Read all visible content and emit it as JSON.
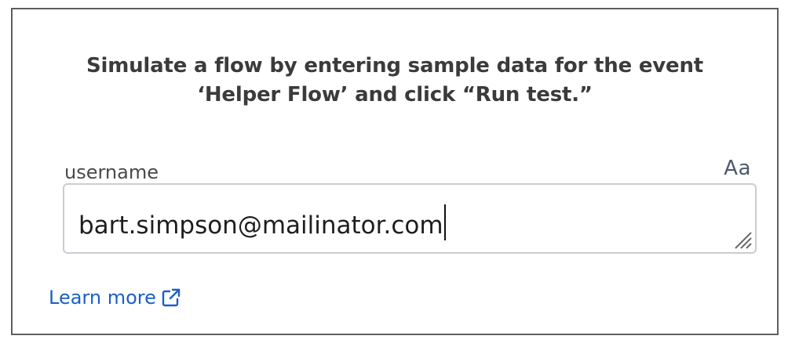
{
  "dialog": {
    "instructions_line1": "Simulate a flow by entering sample data for the event",
    "instructions_line2": "‘Helper Flow’ and click “Run test.”"
  },
  "field": {
    "label": "username",
    "type_indicator": "Aa",
    "value": "bart.simpson@mailinator.com",
    "resize_icon": "resize-grip-icon"
  },
  "footer": {
    "learn_more_label": "Learn more",
    "link_icon": "external-link-icon",
    "link_color": "#1a5fc8"
  }
}
